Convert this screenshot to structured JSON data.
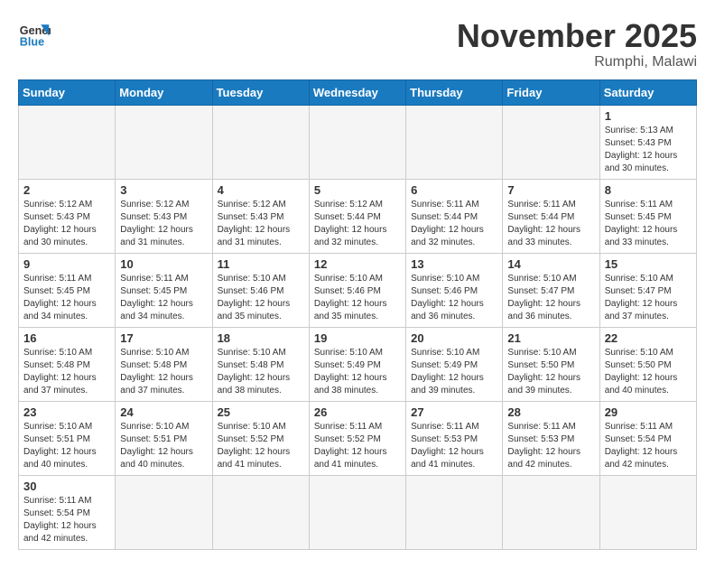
{
  "logo": {
    "general": "General",
    "blue": "Blue"
  },
  "header": {
    "month": "November 2025",
    "location": "Rumphi, Malawi"
  },
  "weekdays": [
    "Sunday",
    "Monday",
    "Tuesday",
    "Wednesday",
    "Thursday",
    "Friday",
    "Saturday"
  ],
  "weeks": [
    [
      {
        "day": "",
        "info": ""
      },
      {
        "day": "",
        "info": ""
      },
      {
        "day": "",
        "info": ""
      },
      {
        "day": "",
        "info": ""
      },
      {
        "day": "",
        "info": ""
      },
      {
        "day": "",
        "info": ""
      },
      {
        "day": "1",
        "info": "Sunrise: 5:13 AM\nSunset: 5:43 PM\nDaylight: 12 hours and 30 minutes."
      }
    ],
    [
      {
        "day": "2",
        "info": "Sunrise: 5:12 AM\nSunset: 5:43 PM\nDaylight: 12 hours and 30 minutes."
      },
      {
        "day": "3",
        "info": "Sunrise: 5:12 AM\nSunset: 5:43 PM\nDaylight: 12 hours and 31 minutes."
      },
      {
        "day": "4",
        "info": "Sunrise: 5:12 AM\nSunset: 5:43 PM\nDaylight: 12 hours and 31 minutes."
      },
      {
        "day": "5",
        "info": "Sunrise: 5:12 AM\nSunset: 5:44 PM\nDaylight: 12 hours and 32 minutes."
      },
      {
        "day": "6",
        "info": "Sunrise: 5:11 AM\nSunset: 5:44 PM\nDaylight: 12 hours and 32 minutes."
      },
      {
        "day": "7",
        "info": "Sunrise: 5:11 AM\nSunset: 5:44 PM\nDaylight: 12 hours and 33 minutes."
      },
      {
        "day": "8",
        "info": "Sunrise: 5:11 AM\nSunset: 5:45 PM\nDaylight: 12 hours and 33 minutes."
      }
    ],
    [
      {
        "day": "9",
        "info": "Sunrise: 5:11 AM\nSunset: 5:45 PM\nDaylight: 12 hours and 34 minutes."
      },
      {
        "day": "10",
        "info": "Sunrise: 5:11 AM\nSunset: 5:45 PM\nDaylight: 12 hours and 34 minutes."
      },
      {
        "day": "11",
        "info": "Sunrise: 5:10 AM\nSunset: 5:46 PM\nDaylight: 12 hours and 35 minutes."
      },
      {
        "day": "12",
        "info": "Sunrise: 5:10 AM\nSunset: 5:46 PM\nDaylight: 12 hours and 35 minutes."
      },
      {
        "day": "13",
        "info": "Sunrise: 5:10 AM\nSunset: 5:46 PM\nDaylight: 12 hours and 36 minutes."
      },
      {
        "day": "14",
        "info": "Sunrise: 5:10 AM\nSunset: 5:47 PM\nDaylight: 12 hours and 36 minutes."
      },
      {
        "day": "15",
        "info": "Sunrise: 5:10 AM\nSunset: 5:47 PM\nDaylight: 12 hours and 37 minutes."
      }
    ],
    [
      {
        "day": "16",
        "info": "Sunrise: 5:10 AM\nSunset: 5:48 PM\nDaylight: 12 hours and 37 minutes."
      },
      {
        "day": "17",
        "info": "Sunrise: 5:10 AM\nSunset: 5:48 PM\nDaylight: 12 hours and 37 minutes."
      },
      {
        "day": "18",
        "info": "Sunrise: 5:10 AM\nSunset: 5:48 PM\nDaylight: 12 hours and 38 minutes."
      },
      {
        "day": "19",
        "info": "Sunrise: 5:10 AM\nSunset: 5:49 PM\nDaylight: 12 hours and 38 minutes."
      },
      {
        "day": "20",
        "info": "Sunrise: 5:10 AM\nSunset: 5:49 PM\nDaylight: 12 hours and 39 minutes."
      },
      {
        "day": "21",
        "info": "Sunrise: 5:10 AM\nSunset: 5:50 PM\nDaylight: 12 hours and 39 minutes."
      },
      {
        "day": "22",
        "info": "Sunrise: 5:10 AM\nSunset: 5:50 PM\nDaylight: 12 hours and 40 minutes."
      }
    ],
    [
      {
        "day": "23",
        "info": "Sunrise: 5:10 AM\nSunset: 5:51 PM\nDaylight: 12 hours and 40 minutes."
      },
      {
        "day": "24",
        "info": "Sunrise: 5:10 AM\nSunset: 5:51 PM\nDaylight: 12 hours and 40 minutes."
      },
      {
        "day": "25",
        "info": "Sunrise: 5:10 AM\nSunset: 5:52 PM\nDaylight: 12 hours and 41 minutes."
      },
      {
        "day": "26",
        "info": "Sunrise: 5:11 AM\nSunset: 5:52 PM\nDaylight: 12 hours and 41 minutes."
      },
      {
        "day": "27",
        "info": "Sunrise: 5:11 AM\nSunset: 5:53 PM\nDaylight: 12 hours and 41 minutes."
      },
      {
        "day": "28",
        "info": "Sunrise: 5:11 AM\nSunset: 5:53 PM\nDaylight: 12 hours and 42 minutes."
      },
      {
        "day": "29",
        "info": "Sunrise: 5:11 AM\nSunset: 5:54 PM\nDaylight: 12 hours and 42 minutes."
      }
    ],
    [
      {
        "day": "30",
        "info": "Sunrise: 5:11 AM\nSunset: 5:54 PM\nDaylight: 12 hours and 42 minutes."
      },
      {
        "day": "",
        "info": ""
      },
      {
        "day": "",
        "info": ""
      },
      {
        "day": "",
        "info": ""
      },
      {
        "day": "",
        "info": ""
      },
      {
        "day": "",
        "info": ""
      },
      {
        "day": "",
        "info": ""
      }
    ]
  ]
}
